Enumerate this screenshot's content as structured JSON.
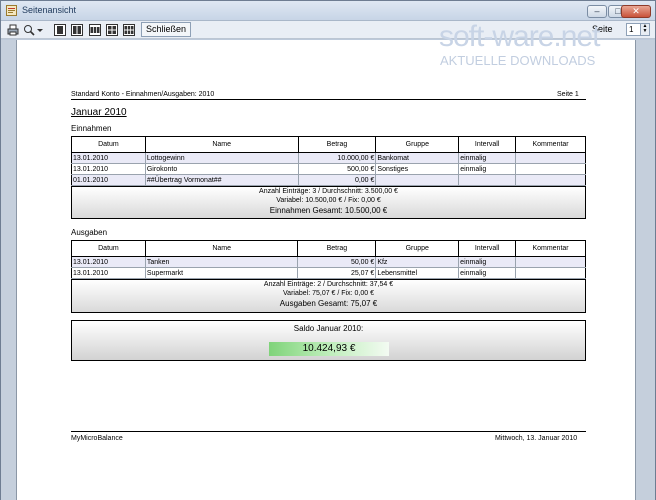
{
  "window": {
    "title": "Seitenansicht",
    "min_glyph": "–",
    "max_glyph": "□",
    "close_glyph": "✕"
  },
  "toolbar": {
    "close_label": "Schließen",
    "page_label": "Seite",
    "page_value": "1"
  },
  "watermark": {
    "main": "soft-ware.net",
    "sub": "AKTUELLE DOWNLOADS"
  },
  "report": {
    "header_left": "Standard Konto - Einnahmen/Ausgaben: 2010",
    "header_right": "Seite 1",
    "month": "Januar 2010",
    "footer_left": "MyMicroBalance",
    "footer_right": "Mittwoch, 13. Januar 2010",
    "columns": [
      "Datum",
      "Name",
      "Betrag",
      "Gruppe",
      "Intervall",
      "Kommentar"
    ],
    "income": {
      "title": "Einnahmen",
      "rows": [
        [
          "13.01.2010",
          "Lottogewinn",
          "10.000,00 €",
          "Bankomat",
          "einmalig",
          ""
        ],
        [
          "13.01.2010",
          "Girokonto",
          "500,00 €",
          "Sonstiges",
          "einmalig",
          ""
        ],
        [
          "01.01.2010",
          "##Übertrag Vormonat##",
          "0,00 €",
          "",
          "",
          ""
        ]
      ],
      "summary_1": "Anzahl Einträge: 3 / Durchschnitt: 3.500,00 €",
      "summary_2": "Variabel: 10.500,00 € / Fix: 0,00 €",
      "summary_total": "Einnahmen Gesamt: 10.500,00 €"
    },
    "expenses": {
      "title": "Ausgaben",
      "rows": [
        [
          "13.01.2010",
          "Tanken",
          "50,00 €",
          "Kfz",
          "einmalig",
          ""
        ],
        [
          "13.01.2010",
          "Supermarkt",
          "25,07 €",
          "Lebensmittel",
          "einmalig",
          ""
        ]
      ],
      "summary_1": "Anzahl Einträge: 2 / Durchschnitt: 37,54 €",
      "summary_2": "Variabel: 75,07 € / Fix: 0,00 €",
      "summary_total": "Ausgaben Gesamt: 75,07 €"
    },
    "saldo_label": "Saldo Januar 2010:",
    "saldo_value": "10.424,93 €"
  },
  "colors": {
    "saldo_green": "#7fd37a",
    "row_shade": "#eaeaf7"
  }
}
